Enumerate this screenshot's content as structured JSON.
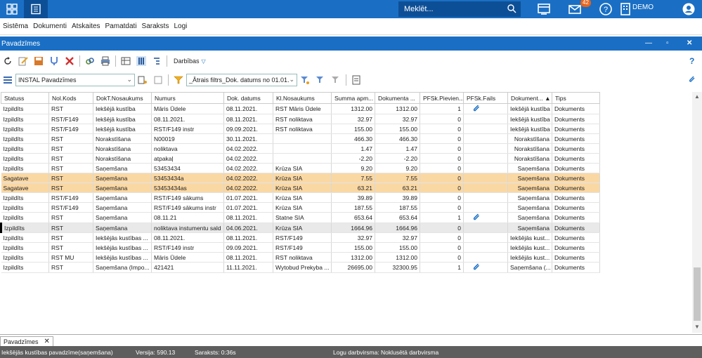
{
  "topbar": {
    "search_placeholder": "Meklēt...",
    "notifications_count": "42",
    "company": "DEMO"
  },
  "menu": [
    "Sistēma",
    "Dokumenti",
    "Atskaites",
    "Pamatdati",
    "Saraksts",
    "Logi"
  ],
  "window": {
    "title": "Pavadzīmes"
  },
  "toolbar": {
    "actions_label": "Darbības"
  },
  "filterbar": {
    "layout_value": "INSTAL Pavadzīmes",
    "filter_value": "_Ātrais filtrs_Dok. datums no 01.01."
  },
  "grid": {
    "columns": [
      "Statuss",
      "Nol.Kods",
      "DokT.Nosaukums",
      "Numurs",
      "Dok. datums",
      "Kl.Nosaukums",
      "Summa apm...",
      "Dokumenta ...",
      "PFSk.Pievien...",
      "PFSk.Fails",
      "Dokument... ▲",
      "Tips"
    ],
    "rows": [
      {
        "status": "Izpildīts",
        "code": "RST",
        "doctype": "Iekšējā kustība",
        "number": "Māris Ūdele",
        "date": "08.11.2021.",
        "client": "RST Māris Ūdele",
        "sum": "1312.00",
        "docsum": "1312.00",
        "attached": "1",
        "file": true,
        "docname": "Iekšējā kustība",
        "type": "Dokuments",
        "rowclass": ""
      },
      {
        "status": "Izpildīts",
        "code": "RST/F149",
        "doctype": "Iekšējā kustība",
        "number": "08.11.2021.",
        "date": "08.11.2021.",
        "client": "RST noliktava",
        "sum": "32.97",
        "docsum": "32.97",
        "attached": "0",
        "file": false,
        "docname": "Iekšējā kustība",
        "type": "Dokuments",
        "rowclass": ""
      },
      {
        "status": "Izpildīts",
        "code": "RST/F149",
        "doctype": "Iekšējā kustība",
        "number": "RST/F149 instr",
        "date": "09.09.2021.",
        "client": "RST noliktava",
        "sum": "155.00",
        "docsum": "155.00",
        "attached": "0",
        "file": false,
        "docname": "Iekšējā kustība",
        "type": "Dokuments",
        "rowclass": ""
      },
      {
        "status": "Izpildīts",
        "code": "RST",
        "doctype": "Norakstīšana",
        "number": "N00019",
        "date": "30.11.2021.",
        "client": "",
        "sum": "466.30",
        "docsum": "466.30",
        "attached": "0",
        "file": false,
        "docname": "Norakstīšana",
        "type": "Dokuments",
        "rowclass": ""
      },
      {
        "status": "Izpildīts",
        "code": "RST",
        "doctype": "Norakstīšana",
        "number": "noliktava",
        "date": "04.02.2022.",
        "client": "",
        "sum": "1.47",
        "docsum": "1.47",
        "attached": "0",
        "file": false,
        "docname": "Norakstīšana",
        "type": "Dokuments",
        "rowclass": ""
      },
      {
        "status": "Izpildīts",
        "code": "RST",
        "doctype": "Norakstīšana",
        "number": "atpakaļ",
        "date": "04.02.2022.",
        "client": "",
        "sum": "-2.20",
        "docsum": "-2.20",
        "attached": "0",
        "file": false,
        "docname": "Norakstīšana",
        "type": "Dokuments",
        "rowclass": ""
      },
      {
        "status": "Izpildīts",
        "code": "RST",
        "doctype": "Saņemšana",
        "number": "53453434",
        "date": "04.02.2022.",
        "client": "Krūza SIA",
        "sum": "9.20",
        "docsum": "9.20",
        "attached": "0",
        "file": false,
        "docname": "Saņemšana",
        "type": "Dokuments",
        "rowclass": ""
      },
      {
        "status": "Sagatave",
        "code": "RST",
        "doctype": "Saņemšana",
        "number": "53453434a",
        "date": "04.02.2022.",
        "client": "Krūza SIA",
        "sum": "7.55",
        "docsum": "7.55",
        "attached": "0",
        "file": false,
        "docname": "Saņemšana",
        "type": "Dokuments",
        "rowclass": "hl"
      },
      {
        "status": "Sagatave",
        "code": "RST",
        "doctype": "Saņemšana",
        "number": "53453434as",
        "date": "04.02.2022.",
        "client": "Krūza SIA",
        "sum": "63.21",
        "docsum": "63.21",
        "attached": "0",
        "file": false,
        "docname": "Saņemšana",
        "type": "Dokuments",
        "rowclass": "hl"
      },
      {
        "status": "Izpildīts",
        "code": "RST/F149",
        "doctype": "Saņemšana",
        "number": "RST/F149 sākums",
        "date": "01.07.2021.",
        "client": "Krūza SIA",
        "sum": "39.89",
        "docsum": "39.89",
        "attached": "0",
        "file": false,
        "docname": "Saņemšana",
        "type": "Dokuments",
        "rowclass": ""
      },
      {
        "status": "Izpildīts",
        "code": "RST/F149",
        "doctype": "Saņemšana",
        "number": "RST/F149 sākums instr",
        "date": "01.07.2021.",
        "client": "Krūza SIA",
        "sum": "187.55",
        "docsum": "187.55",
        "attached": "0",
        "file": false,
        "docname": "Saņemšana",
        "type": "Dokuments",
        "rowclass": ""
      },
      {
        "status": "Izpildīts",
        "code": "RST",
        "doctype": "Saņemšana",
        "number": "08.11.21",
        "date": "08.11.2021.",
        "client": "Statne SIA",
        "sum": "653.64",
        "docsum": "653.64",
        "attached": "1",
        "file": true,
        "docname": "Saņemšana",
        "type": "Dokuments",
        "rowclass": ""
      },
      {
        "status": "Izpildīts",
        "code": "RST",
        "doctype": "Saņemšana",
        "number": "noliktava instumentu sald",
        "date": "04.06.2021.",
        "client": "Krūza SIA",
        "sum": "1664.96",
        "docsum": "1664.96",
        "attached": "0",
        "file": false,
        "docname": "Saņemšana",
        "type": "Dokuments",
        "rowclass": "sel cur"
      },
      {
        "status": "Izpildīts",
        "code": "RST",
        "doctype": "Iekšējās kustības ...",
        "number": "08.11.2021.",
        "date": "08.11.2021.",
        "client": "RST/F149",
        "sum": "32.97",
        "docsum": "32.97",
        "attached": "0",
        "file": false,
        "docname": "Iekšējās kust...",
        "type": "Dokuments",
        "rowclass": ""
      },
      {
        "status": "Izpildīts",
        "code": "RST",
        "doctype": "Iekšējās kustības ...",
        "number": "RST/F149 instr",
        "date": "09.09.2021.",
        "client": "RST/F149",
        "sum": "155.00",
        "docsum": "155.00",
        "attached": "0",
        "file": false,
        "docname": "Iekšējās kust...",
        "type": "Dokuments",
        "rowclass": ""
      },
      {
        "status": "Izpildīts",
        "code": "RST MU",
        "doctype": "Iekšējās kustības ...",
        "number": "Māris Ūdele",
        "date": "08.11.2021.",
        "client": "RST noliktava",
        "sum": "1312.00",
        "docsum": "1312.00",
        "attached": "0",
        "file": false,
        "docname": "Iekšējās kust...",
        "type": "Dokuments",
        "rowclass": ""
      },
      {
        "status": "Izpildīts",
        "code": "RST",
        "doctype": "Saņemšana (Impo...",
        "number": "421421",
        "date": "11.11.2021.",
        "client": "Wytobud Prekyba ...",
        "sum": "26695.00",
        "docsum": "32300.95",
        "attached": "1",
        "file": true,
        "docname": "Saņemšana (...",
        "type": "Dokuments",
        "rowclass": ""
      }
    ]
  },
  "bottom": {
    "tab_label": "Pavadzīmes",
    "status_doc": "Iekšējās kustības pavadzīme(saņemšana)",
    "status_version": "Versija: 590.13",
    "status_list": "Saraksts: 0:36s",
    "status_logs": "Logu darbvirsma: Noklusētā darbvirsma"
  },
  "colors": {
    "brand": "#1a6fc4",
    "highlight_row": "#fad8a4",
    "statusbar": "#5e5e5e"
  }
}
